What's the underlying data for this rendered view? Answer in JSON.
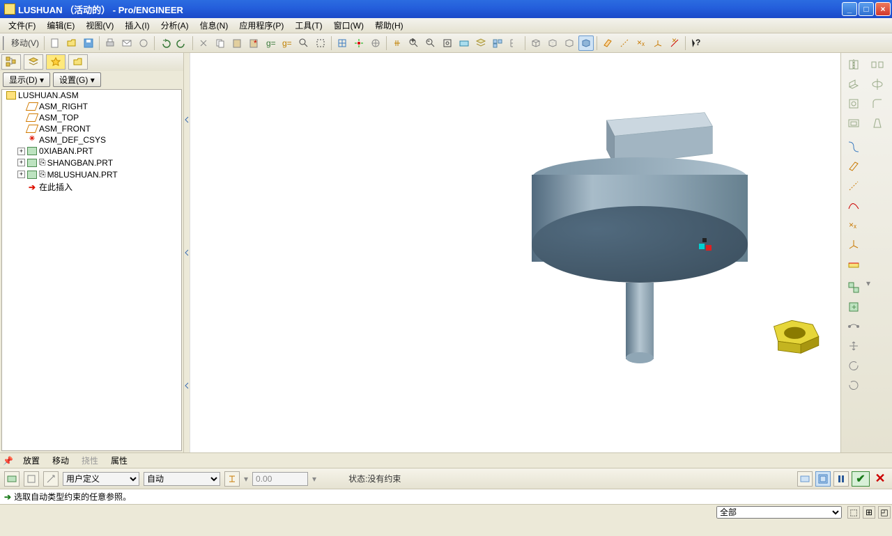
{
  "title": "LUSHUAN （活动的） - Pro/ENGINEER",
  "menus": [
    "文件(F)",
    "编辑(E)",
    "视图(V)",
    "插入(I)",
    "分析(A)",
    "信息(N)",
    "应用程序(P)",
    "工具(T)",
    "窗口(W)",
    "帮助(H)"
  ],
  "toolbar_first_label": "移动(V)",
  "left_panel": {
    "display_btn": "显示(D) ▾",
    "settings_btn": "设置(G) ▾",
    "tree": [
      {
        "icon": "asm",
        "label": "LUSHUAN.ASM",
        "indent": 0
      },
      {
        "icon": "datum",
        "label": "ASM_RIGHT",
        "indent": 1
      },
      {
        "icon": "datum",
        "label": "ASM_TOP",
        "indent": 1
      },
      {
        "icon": "datum",
        "label": "ASM_FRONT",
        "indent": 1
      },
      {
        "icon": "csys",
        "label": "ASM_DEF_CSYS",
        "indent": 1
      },
      {
        "icon": "prt",
        "label": "0XIABAN.PRT",
        "indent": 1,
        "exp": "+"
      },
      {
        "icon": "prt",
        "label": "SHANGBAN.PRT",
        "indent": 1,
        "exp": "+",
        "pref": "⎘"
      },
      {
        "icon": "prt",
        "label": "M8LUSHUAN.PRT",
        "indent": 1,
        "exp": "+",
        "pref": "⎘"
      },
      {
        "icon": "arrow",
        "label": "在此插入",
        "indent": 1
      }
    ]
  },
  "bottom_tabs": {
    "pin": "📌",
    "place": "放置",
    "move": "移动",
    "flex": "挠性",
    "props": "属性"
  },
  "dashboard": {
    "sel1": "用户定义",
    "sel2": "自动",
    "num": "0.00",
    "state_label": "状态:没有约束"
  },
  "message": "选取自动类型约束的任意参照。",
  "statusbar": {
    "filter": "全部"
  }
}
